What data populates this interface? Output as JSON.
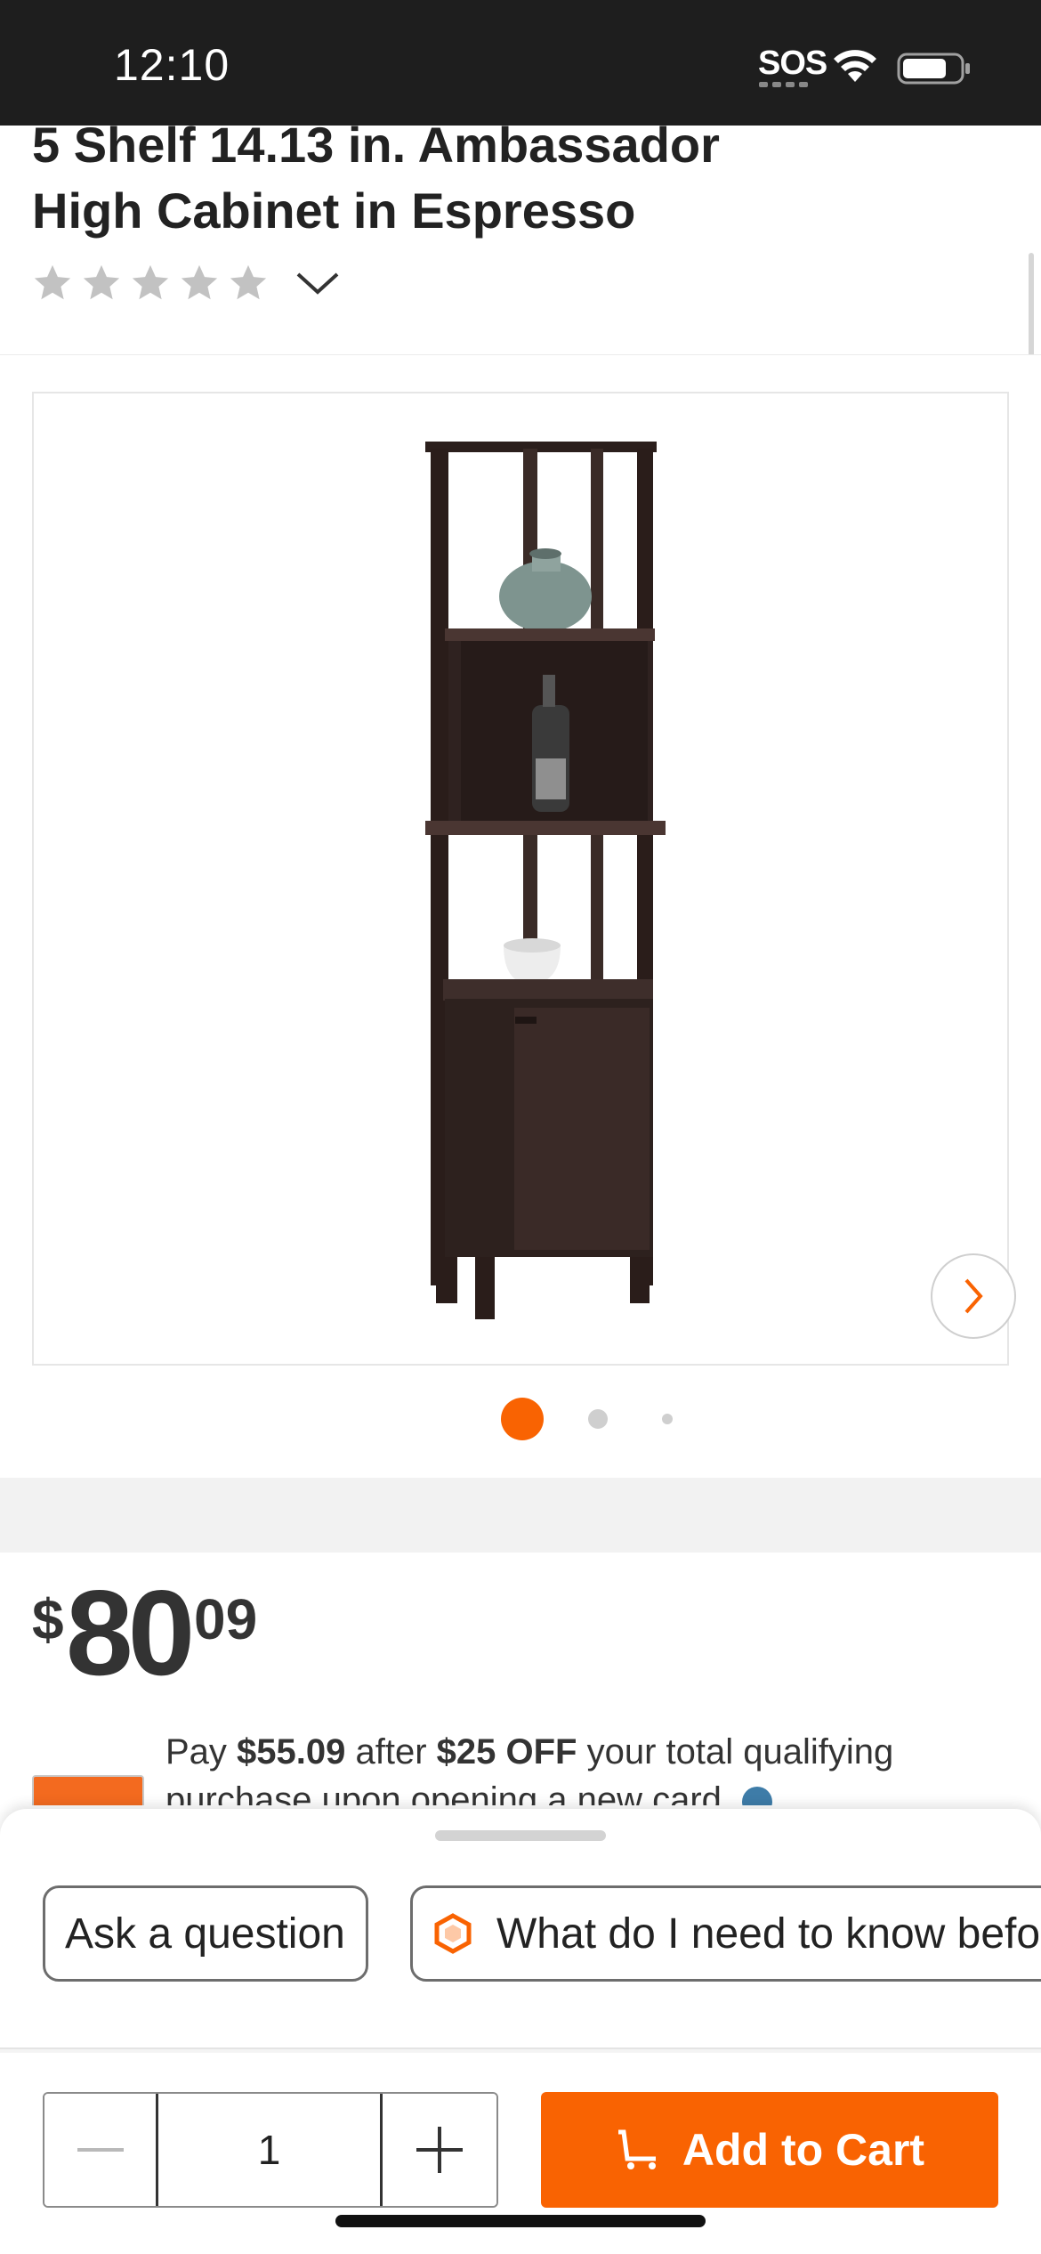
{
  "status_bar": {
    "time": "12:10",
    "sos": "SOS"
  },
  "product": {
    "title_line1": "5 Shelf 14.13 in. Ambassador",
    "title_line2": "High Cabinet in Espresso",
    "rating_stars": 0
  },
  "gallery": {
    "image_alt": "Espresso high cabinet with shelves",
    "page_count": 3,
    "active_index": 0
  },
  "price": {
    "currency": "$",
    "dollars": "80",
    "cents": "09"
  },
  "promo": {
    "pay_prefix": "Pay ",
    "pay_amount": "$55.09",
    "after_text": " after ",
    "discount": "$25 OFF",
    "rest": " your total qualifying",
    "line2": "purchase upon opening a new card."
  },
  "chips": {
    "ask": "Ask a question",
    "know": "What do I need to know before buying?"
  },
  "cart": {
    "quantity": "1",
    "add_label": "Add to Cart"
  },
  "colors": {
    "brand_orange": "#f96302",
    "status_bar": "#1e1e1e",
    "star_empty": "#c2c2c2"
  }
}
